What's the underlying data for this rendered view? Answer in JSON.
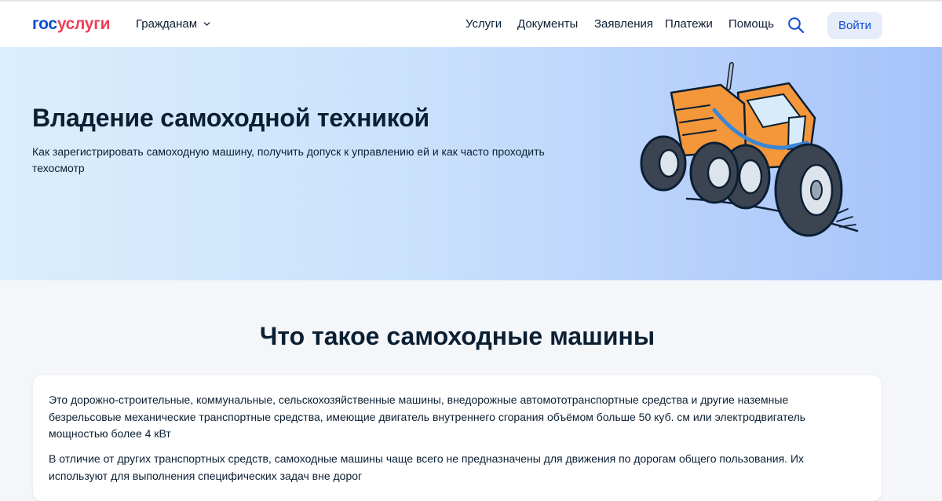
{
  "header": {
    "logo_part1": "гос",
    "logo_part2": "услуги",
    "audience": "Гражданам",
    "nav": [
      "Услуги",
      "Документы",
      "Заявления",
      "Платежи",
      "Помощь"
    ],
    "login_label": "Войти",
    "icons": {
      "audience": "chevron-down-icon",
      "search": "search-icon"
    }
  },
  "hero": {
    "title": "Владение самоходной техникой",
    "description": "Как зарегистрировать самоходную машину, получить допуск к управлению ей и как часто проходить техосмотр",
    "illustration": "tractor-illustration"
  },
  "section": {
    "title": "Что такое самоходные машины",
    "paragraph1": "Это дорожно-строительные, коммунальные, сельскохозяйственные машины, внедорожные автомототранспортные средства и другие наземные безрельсовые механические транспортные средства, имеющие двигатель внутреннего сгорания объёмом больше 50 куб. см или электродвигатель мощностью более 4 кВт",
    "paragraph2": "В отличие от других транспортных средств, самоходные машины чаще всего не предназначены для движения по дорогам общего пользования. Их используют для выполнения специфических задач вне дорог"
  },
  "colors": {
    "brand_blue": "#0d4cd3",
    "brand_red": "#ee3f58",
    "text": "#0b1f33",
    "tractor_orange": "#f4963a"
  }
}
